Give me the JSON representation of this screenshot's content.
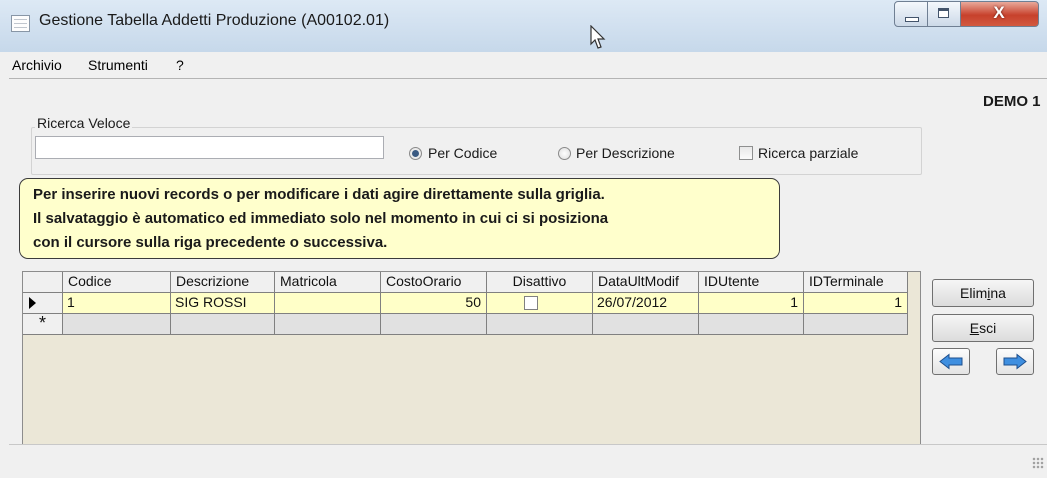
{
  "window": {
    "title": "Gestione Tabella Addetti Produzione (A00102.01)",
    "close_glyph": "X",
    "icons": [
      "app-window-icon",
      "mouse-cursor-icon",
      "minimize-icon",
      "maximize-icon",
      "close-icon"
    ]
  },
  "menu": {
    "items": [
      {
        "label": "Archivio"
      },
      {
        "label": "Strumenti"
      },
      {
        "label": "?"
      }
    ]
  },
  "company_label": "DEMO 1",
  "search": {
    "group_label": "Ricerca Veloce",
    "value": "",
    "options": [
      {
        "label": "Per Codice",
        "selected": true
      },
      {
        "label": "Per Descrizione",
        "selected": false
      }
    ],
    "partial": {
      "label": "Ricerca parziale",
      "checked": false
    }
  },
  "info": {
    "lines": [
      "Per inserire nuovi records o per modificare i dati agire direttamente sulla  griglia.",
      "Il salvataggio è automatico ed immediato solo nel momento in cui ci si posiziona",
      "con il cursore sulla riga precedente o successiva."
    ]
  },
  "grid": {
    "columns": [
      "Codice",
      "Descrizione",
      "Matricola",
      "CostoOrario",
      "Disattivo",
      "DataUltModif",
      "IDUtente",
      "IDTerminale"
    ],
    "rows": [
      {
        "codice": "1",
        "descrizione": "SIG ROSSI",
        "matricola": "",
        "costo_orario": "50",
        "disattivo": false,
        "data_ult_modif": "26/07/2012",
        "id_utente": "1",
        "id_terminale": "1"
      }
    ],
    "new_row_marker": "*"
  },
  "buttons": {
    "elimina": {
      "pre": "Elim",
      "accel": "i",
      "post": "na"
    },
    "esci": {
      "pre": "",
      "accel": "E",
      "post": "sci"
    },
    "prev_icon": "arrow-left-icon",
    "next_icon": "arrow-right-icon"
  },
  "colors": {
    "info_background": "#ffffcc",
    "row_background": "#ffffc8",
    "grid_background": "#ebe7d7",
    "close_button": "#c7412c",
    "arrow_fill": "#3f8fe0"
  }
}
